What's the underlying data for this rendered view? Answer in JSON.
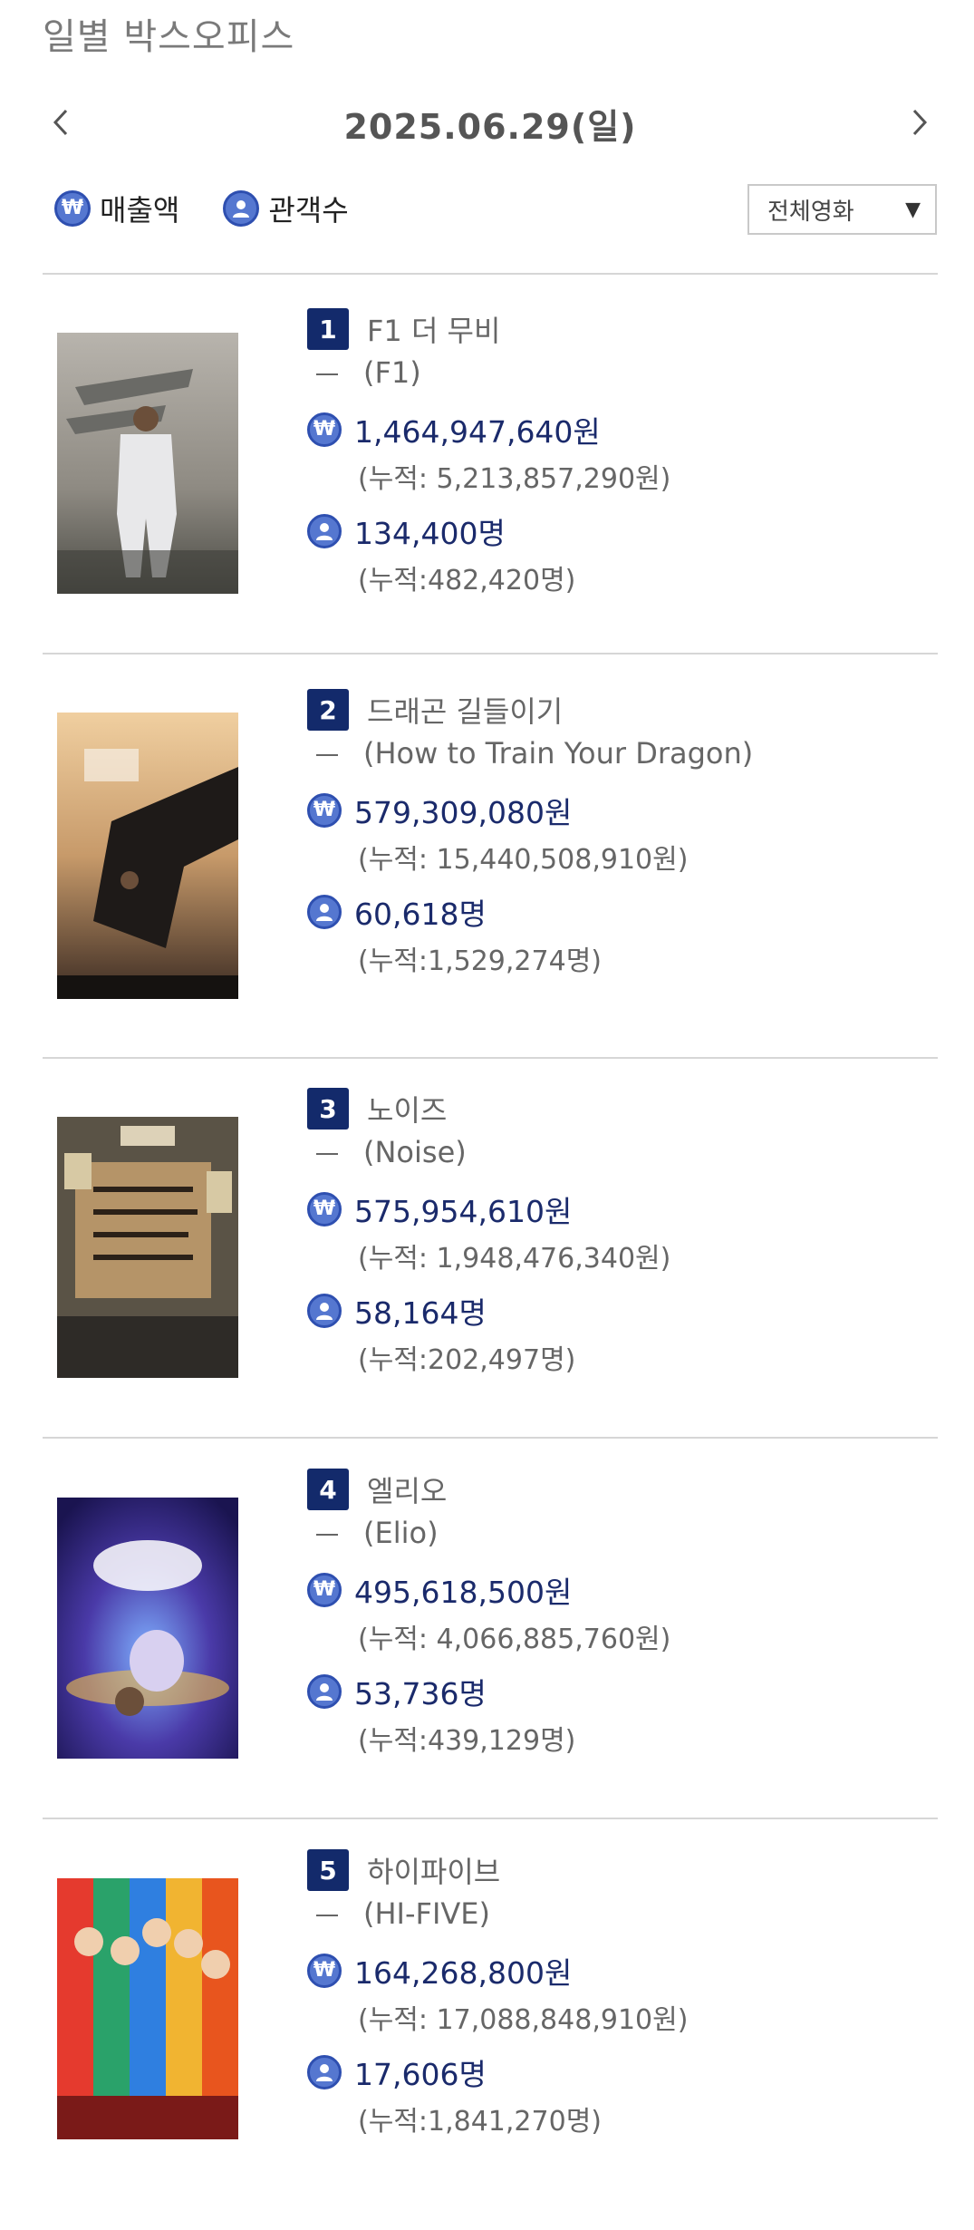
{
  "page_title": "일별 박스오피스",
  "date_nav": {
    "date": "2025.06.29(일)"
  },
  "legend": {
    "sales_label": "매출액",
    "audience_label": "관객수"
  },
  "filter": {
    "selected": "전체영화"
  },
  "colors": {
    "accent": "#132a6b",
    "icon": "#5577d0",
    "value_text": "#1a2a6b"
  },
  "movies": [
    {
      "rank": "1",
      "title": "F1 더 무비",
      "original_title": "(F1)",
      "sales": "1,464,947,640원",
      "sales_cumulative": "(누적: 5,213,857,290원)",
      "audience": "134,400명",
      "audience_cumulative": "(누적:482,420명)"
    },
    {
      "rank": "2",
      "title": "드래곤 길들이기",
      "original_title": "(How to Train Your Dragon)",
      "sales": "579,309,080원",
      "sales_cumulative": "(누적: 15,440,508,910원)",
      "audience": "60,618명",
      "audience_cumulative": "(누적:1,529,274명)"
    },
    {
      "rank": "3",
      "title": "노이즈",
      "original_title": "(Noise)",
      "sales": "575,954,610원",
      "sales_cumulative": "(누적: 1,948,476,340원)",
      "audience": "58,164명",
      "audience_cumulative": "(누적:202,497명)"
    },
    {
      "rank": "4",
      "title": "엘리오",
      "original_title": "(Elio)",
      "sales": "495,618,500원",
      "sales_cumulative": "(누적: 4,066,885,760원)",
      "audience": "53,736명",
      "audience_cumulative": "(누적:439,129명)"
    },
    {
      "rank": "5",
      "title": "하이파이브",
      "original_title": "(HI-FIVE)",
      "sales": "164,268,800원",
      "sales_cumulative": "(누적: 17,088,848,910원)",
      "audience": "17,606명",
      "audience_cumulative": "(누적:1,841,270명)"
    }
  ]
}
